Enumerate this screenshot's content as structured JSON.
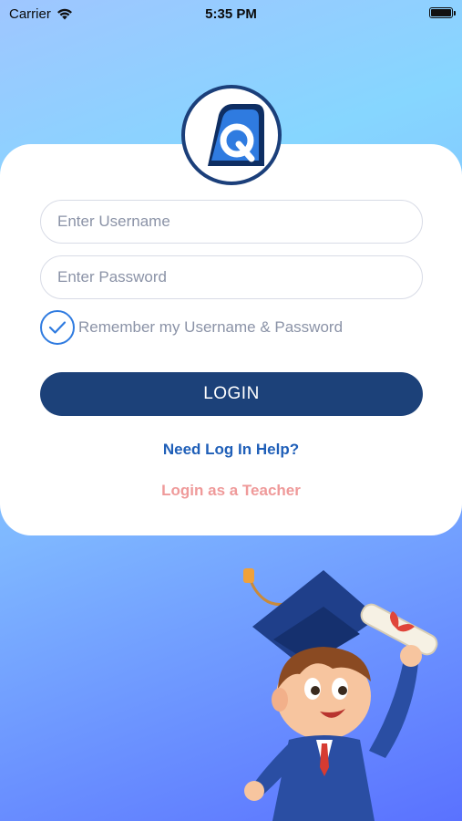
{
  "status_bar": {
    "carrier": "Carrier",
    "time": "5:35 PM",
    "battery_level": 1.0
  },
  "login": {
    "logo_letter": "Q",
    "username_placeholder": "Enter Username",
    "password_placeholder": "Enter Password",
    "remember_label": "Remember my Username & Password",
    "remember_checked": true,
    "login_button": "LOGIN",
    "help_link": "Need Log In Help?",
    "teacher_link": "Login as a Teacher"
  },
  "colors": {
    "primary": "#1c4179",
    "link_blue": "#1f5fb8",
    "teacher_pink": "#ef9a9a",
    "checkbox_blue": "#2f7be0"
  },
  "icons": [
    "wifi-icon",
    "battery-icon",
    "checkmark-icon",
    "app-logo-icon",
    "graduate-mascot"
  ]
}
